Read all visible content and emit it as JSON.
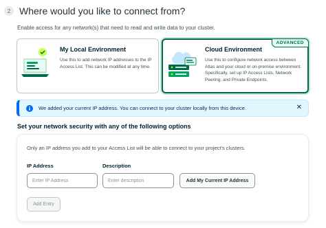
{
  "step": {
    "number": "2",
    "title": "Where would you like to connect from?"
  },
  "intro": "Enable access for any network(s) that need to read and write data to your cluster.",
  "cards": {
    "local": {
      "title": "My Local Environment",
      "description": "Use this to add network IP addresses to the IP Access List. This can be modified at any time.",
      "illustration": "laptop-illustration-icon",
      "selected": false
    },
    "cloud": {
      "title": "Cloud Environment",
      "description": "Use this to configure network access between Atlas and your cloud or on-premise environment. Specifically, set up IP Access Lists, Network Peering, and Private Endpoints.",
      "badge": "ADVANCED",
      "illustration": "cloud-server-illustration-icon",
      "selected": true
    }
  },
  "banner": {
    "icon": "info-icon",
    "text": "We added your current IP address. You can connect to your cluster locally from this device.",
    "close_icon": "close-icon",
    "close_label": "✕"
  },
  "security": {
    "title": "Set your network security with any of the following options",
    "description": "Only an IP address you add to your Access List will be able to connect to your project's clusters.",
    "ip_label": "IP Address",
    "ip_placeholder": "Enter IP Address",
    "ip_value": "",
    "desc_label": "Description",
    "desc_placeholder": "Enter description",
    "desc_value": "",
    "current_ip_button": "Add My Current IP Address",
    "add_entry_button": "Add Entry",
    "add_entry_disabled": true
  },
  "colors": {
    "accent_green": "#00684a",
    "banner_blue": "#016bf8",
    "banner_bg": "#e1f7ff"
  }
}
